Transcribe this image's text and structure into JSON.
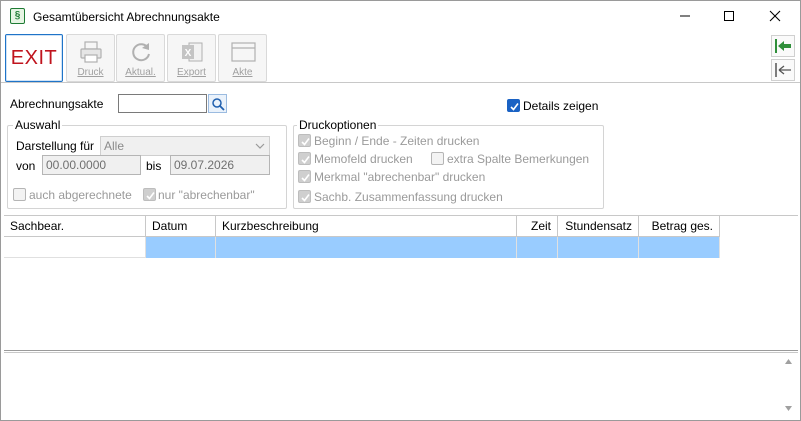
{
  "window": {
    "title": "Gesamtübersicht Abrechnungsakte",
    "app_icon_glyph": "§"
  },
  "toolbar": {
    "exit_label": "EXIT",
    "buttons": [
      {
        "label": "Druck",
        "icon": "printer-icon"
      },
      {
        "label": "Aktual.",
        "icon": "refresh-icon"
      },
      {
        "label": "Export",
        "icon": "excel-icon"
      },
      {
        "label": "Akte",
        "icon": "folder-window-icon"
      }
    ],
    "side_buttons": [
      {
        "icon": "arrow-left-green-icon"
      },
      {
        "icon": "arrow-left-gray-icon"
      }
    ]
  },
  "form": {
    "abrechnungsakte_label": "Abrechnungsakte",
    "abrechnungsakte_value": "",
    "details_label": "Details zeigen",
    "details_checked": true,
    "auswahl": {
      "title": "Auswahl",
      "darstellung_label": "Darstellung für",
      "darstellung_value": "Alle",
      "von_label": "von",
      "von_value": "00.00.0000",
      "bis_label": "bis",
      "bis_value": "09.07.2026",
      "auch_abgerechnete_label": "auch abgerechnete",
      "auch_abgerechnete_checked": false,
      "nur_abrechenbar_label": "nur \"abrechenbar\"",
      "nur_abrechenbar_checked": true
    },
    "druckoptionen": {
      "title": "Druckoptionen",
      "beginn_ende_label": "Beginn / Ende  - Zeiten drucken",
      "beginn_ende_checked": true,
      "memofeld_label": "Memofeld drucken",
      "memofeld_checked": true,
      "extra_spalte_label": "extra Spalte Bemerkungen",
      "extra_spalte_checked": false,
      "merkmal_label": "Merkmal \"abrechenbar\" drucken",
      "merkmal_checked": true,
      "sachb_label": "Sachb. Zusammenfassung drucken",
      "sachb_checked": true
    }
  },
  "grid": {
    "columns": [
      "Sachbear.",
      "Datum",
      "Kurzbeschreibung",
      "Zeit",
      "Stundensatz",
      "Betrag ges."
    ],
    "rows": [
      [
        "",
        "",
        "",
        "",
        "",
        ""
      ]
    ],
    "selected_color": "#99ccff"
  },
  "colors": {
    "exit_text": "#c0141e",
    "checkbox_blue": "#1a62c4",
    "app_icon_green": "#1e7b34"
  }
}
